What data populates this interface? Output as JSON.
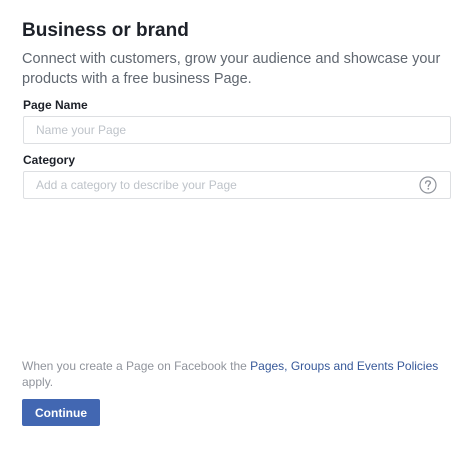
{
  "header": {
    "title": "Business or brand",
    "description": "Connect with customers, grow your audience and showcase your products with a free business Page."
  },
  "form": {
    "page_name": {
      "label": "Page Name",
      "placeholder": "Name your Page",
      "value": ""
    },
    "category": {
      "label": "Category",
      "placeholder": "Add a category to describe your Page",
      "value": "",
      "help_icon": "question-circle-icon"
    }
  },
  "footer": {
    "policy_prefix": "When you create a Page on Facebook the ",
    "policy_link": "Pages, Groups and Events Policies",
    "policy_suffix": " apply.",
    "continue_label": "Continue"
  },
  "colors": {
    "accent": "#4267b2",
    "link": "#365899",
    "text": "#1d2129",
    "muted": "#90949c",
    "border": "#dddfe2"
  }
}
